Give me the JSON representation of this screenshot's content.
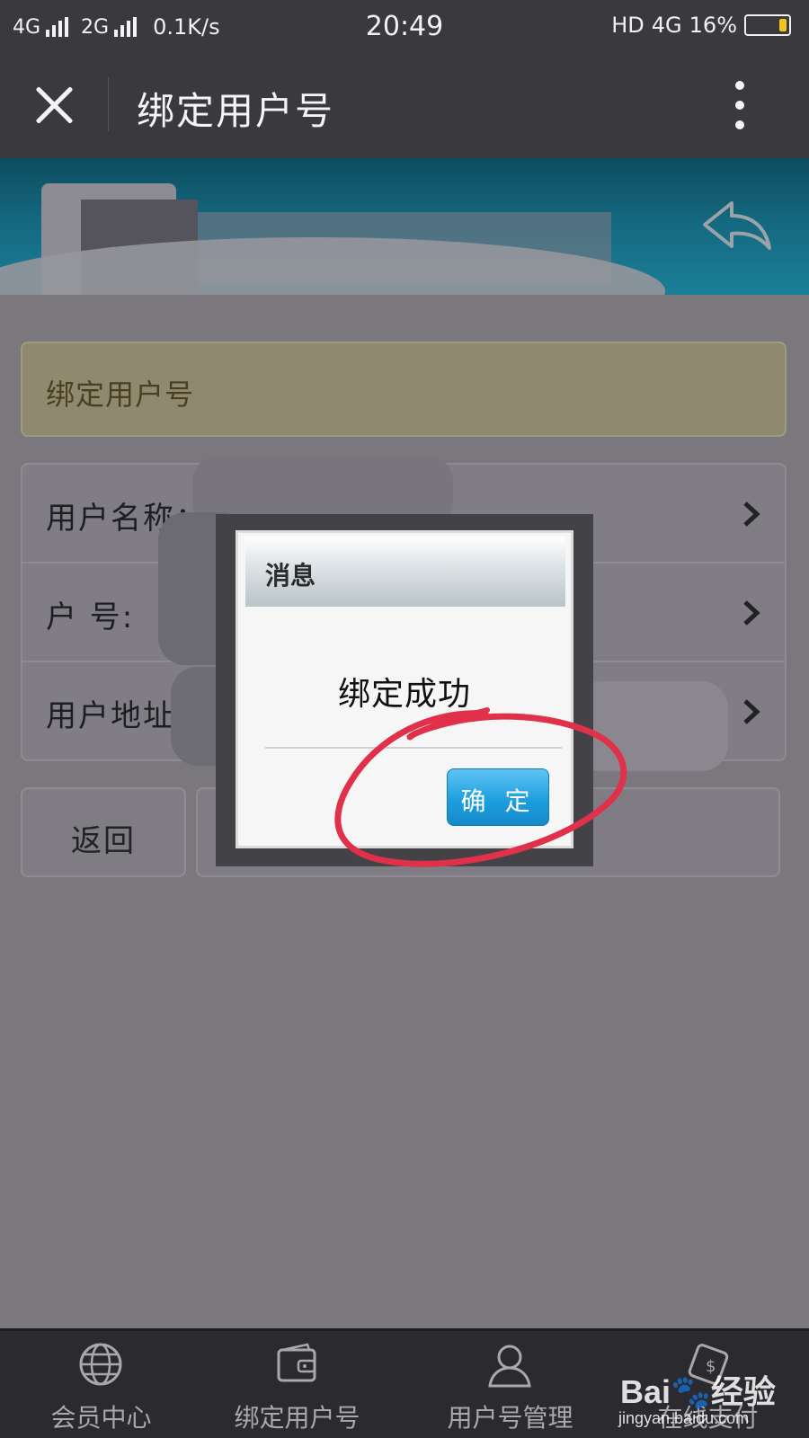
{
  "status_bar": {
    "net1": "4G",
    "net2": "2G",
    "speed": "0.1K/s",
    "time": "20:49",
    "hd": "HD",
    "net3": "4G",
    "battery": "16%",
    "battery_color": "#f2c318"
  },
  "title_bar": {
    "title": "绑定用户号",
    "close_icon": "close-icon",
    "more_icon": "more-vertical-icon"
  },
  "banner": {
    "share_icon": "back-arrow-icon",
    "bg_color": "#14687f"
  },
  "section": {
    "header": "绑定用户号"
  },
  "form": {
    "rows": [
      {
        "label": "用户名称："
      },
      {
        "label": "户 号:"
      },
      {
        "label": "用户地址"
      }
    ]
  },
  "buttons": {
    "back": "返回"
  },
  "dialog": {
    "title": "消息",
    "message": "绑定成功",
    "ok": "确 定",
    "ok_color": "#1e9fe0"
  },
  "annotation": {
    "color": "#e0304a"
  },
  "tabs": [
    {
      "label": "会员中心",
      "icon": "globe-icon"
    },
    {
      "label": "绑定用户号",
      "icon": "wallet-icon"
    },
    {
      "label": "用户号管理",
      "icon": "user-icon"
    },
    {
      "label": "在线支付",
      "icon": "payment-icon"
    }
  ],
  "watermark": {
    "logo": "Bai🐾经验",
    "url": "jingyan.baidu.com"
  }
}
